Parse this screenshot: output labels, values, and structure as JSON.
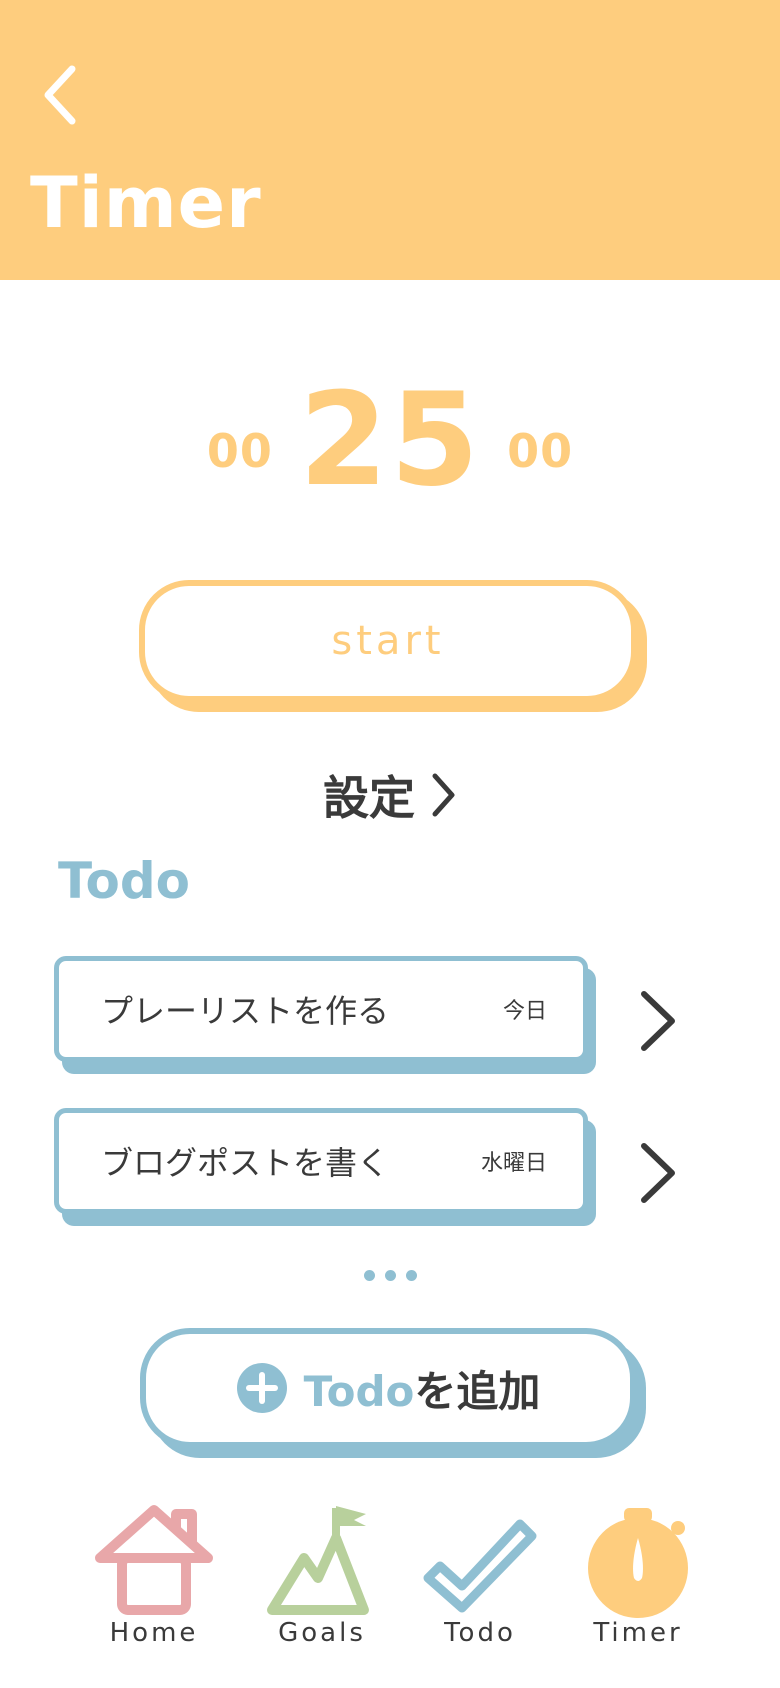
{
  "header": {
    "title": "Timer",
    "back_icon": "chevron-left-icon"
  },
  "timer": {
    "hours": "00",
    "minutes": "25",
    "seconds": "00"
  },
  "start_button": {
    "label": "start"
  },
  "settings": {
    "label": "設定",
    "icon": "chevron-right-icon"
  },
  "todo": {
    "heading": "Todo",
    "items": [
      {
        "text": "プレーリストを作る",
        "day": "今日"
      },
      {
        "text": "ブログポストを書く",
        "day": "水曜日"
      }
    ],
    "more_icon": "ellipsis-icon",
    "add_button": {
      "icon": "plus-circle-icon",
      "word": "Todo",
      "rest": "を追加"
    }
  },
  "nav": {
    "items": [
      {
        "label": "Home",
        "icon": "house-icon",
        "color": "#e8a7a9"
      },
      {
        "label": "Goals",
        "icon": "mountain-flag-icon",
        "color": "#b8d09c"
      },
      {
        "label": "Todo",
        "icon": "checkmark-icon",
        "color": "#8fbfd2"
      },
      {
        "label": "Timer",
        "icon": "stopwatch-icon",
        "color": "#fecd7e"
      }
    ]
  },
  "colors": {
    "accent": "#fecd7e",
    "todo_blue": "#8fbfd2",
    "text": "#3a3a3a"
  }
}
